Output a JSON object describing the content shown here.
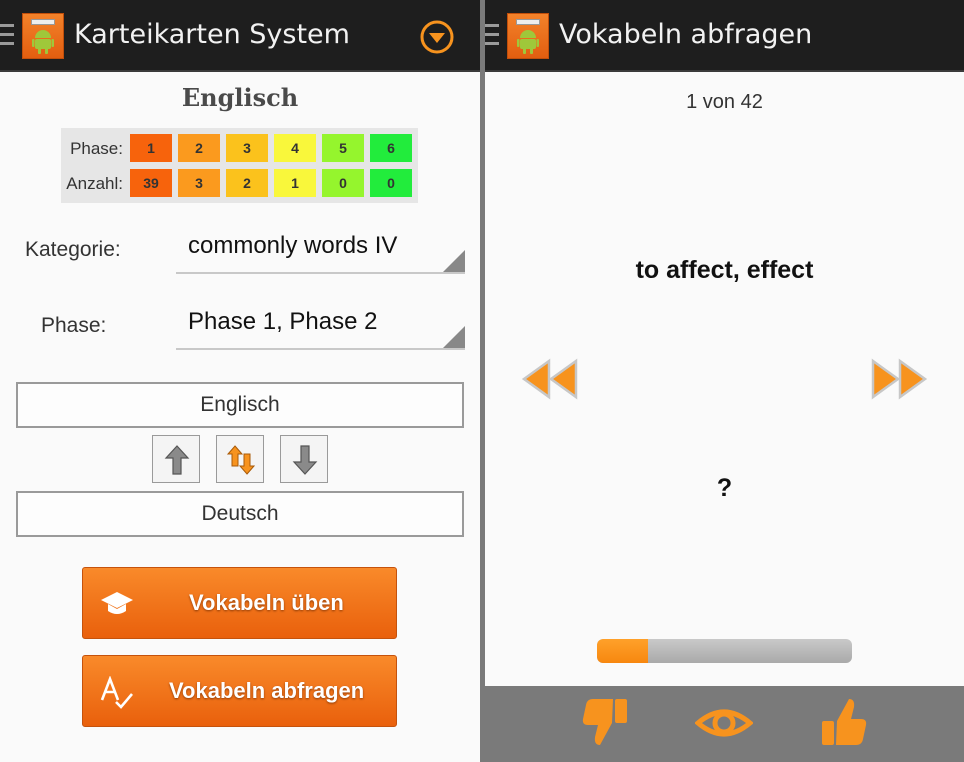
{
  "left": {
    "title": "Karteikarten System",
    "icons": {
      "drawer": "drawer-icon",
      "app": "android-app-icon",
      "overflow": "dropdown-circle-icon"
    },
    "heading": "Englisch",
    "stats": {
      "phase_label": "Phase:",
      "count_label": "Anzahl:",
      "phases": [
        "1",
        "2",
        "3",
        "4",
        "5",
        "6"
      ],
      "counts": [
        "39",
        "3",
        "2",
        "1",
        "0",
        "0"
      ],
      "colors": [
        "#f7630c",
        "#fb9a1e",
        "#fbc21c",
        "#f9f73b",
        "#95f52d",
        "#22ec3c"
      ]
    },
    "category": {
      "label": "Kategorie:",
      "value": "commonly words IV"
    },
    "phase": {
      "label": "Phase:",
      "value": "Phase 1, Phase 2"
    },
    "language_from": "Englisch",
    "language_to": "Deutsch",
    "direction_buttons": [
      "arrow-up-icon",
      "swap-arrows-icon",
      "arrow-down-icon"
    ],
    "practice_button": "Vokabeln üben",
    "quiz_button": "Vokabeln abfragen"
  },
  "right": {
    "title": "Vokabeln abfragen",
    "counter": "1 von 42",
    "word": "to affect, effect",
    "answer": "?",
    "progress": 0.2,
    "accent": "#f7931e",
    "bottom_icons": [
      "thumbs-down-icon",
      "eye-icon",
      "thumbs-up-icon"
    ]
  }
}
